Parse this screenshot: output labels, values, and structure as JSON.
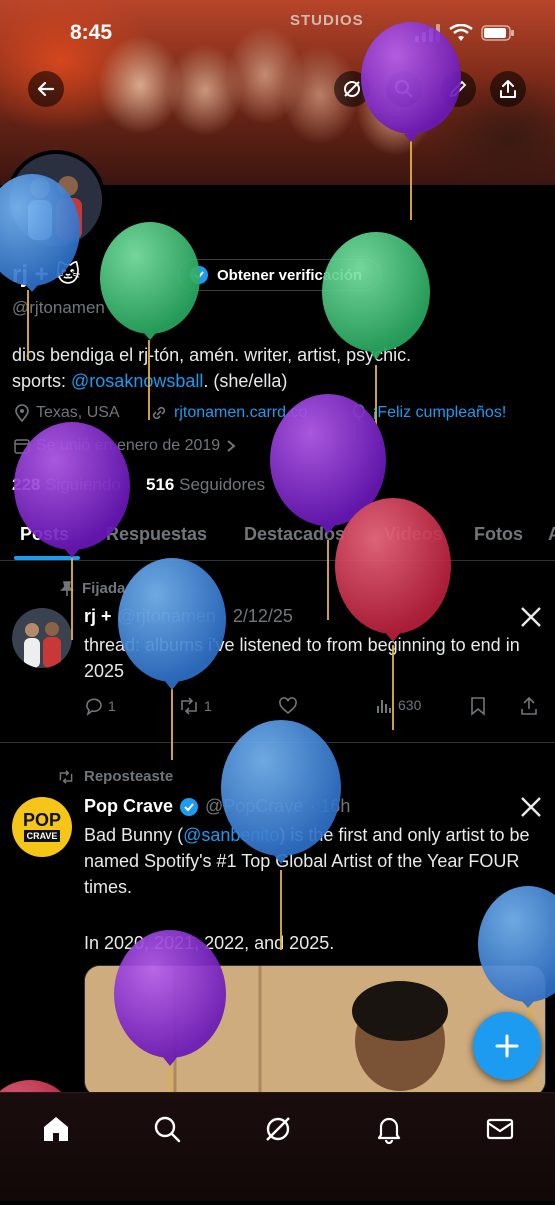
{
  "status_bar": {
    "time": "8:45"
  },
  "banner": {
    "label": "STUDIOS"
  },
  "profile": {
    "name": "rj +",
    "name_emojis": "🐱",
    "verify_label": "Obtener verificación",
    "handle": "@rjtonamen",
    "bio_line1": "dios bendiga el rj-tón, amén. writer, artist, psychic.",
    "bio_prefix": "sports: ",
    "bio_link": "@rosaknowsball",
    "bio_suffix": ". (she/ella)",
    "location": "Texas, USA",
    "website": "rjtonamen.carrd.co",
    "birthday": "¡Feliz cumpleaños!",
    "joined": "Se unió en enero de 2019",
    "following_count": "228",
    "following_label": "Siguiendo",
    "followers_count": "516",
    "followers_label": "Seguidores"
  },
  "tabs": [
    "Posts",
    "Respuestas",
    "Destacados",
    "Videos",
    "Fotos",
    "A"
  ],
  "posts": [
    {
      "context": "Fijada",
      "name": "rj +",
      "handle": "@rjtonamen",
      "date": "· 2/12/25",
      "text": "thread: albums i've listened to from beginning to end in 2025",
      "replies": "1",
      "reposts": "1",
      "views": "630"
    },
    {
      "context": "Reposteaste",
      "name": "Pop Crave",
      "handle": "@PopCrave",
      "date": "· 16h",
      "avatar_text_1": "POP",
      "avatar_text_2": "CRAVE",
      "text_1": "Bad Bunny (",
      "text_link": "@sanbenito",
      "text_2": ") is the first and only artist to be named Spotify's #1 Top Global Artist of the Year FOUR times.",
      "text_3": "In 2020, 2021, 2022, and 2025."
    }
  ],
  "colors": {
    "accent": "#1d9bf0",
    "balloon_purple": "#8a2be2",
    "balloon_blue": "#3d8ee0",
    "balloon_green": "#3ec97a",
    "balloon_red": "#d83a55"
  }
}
